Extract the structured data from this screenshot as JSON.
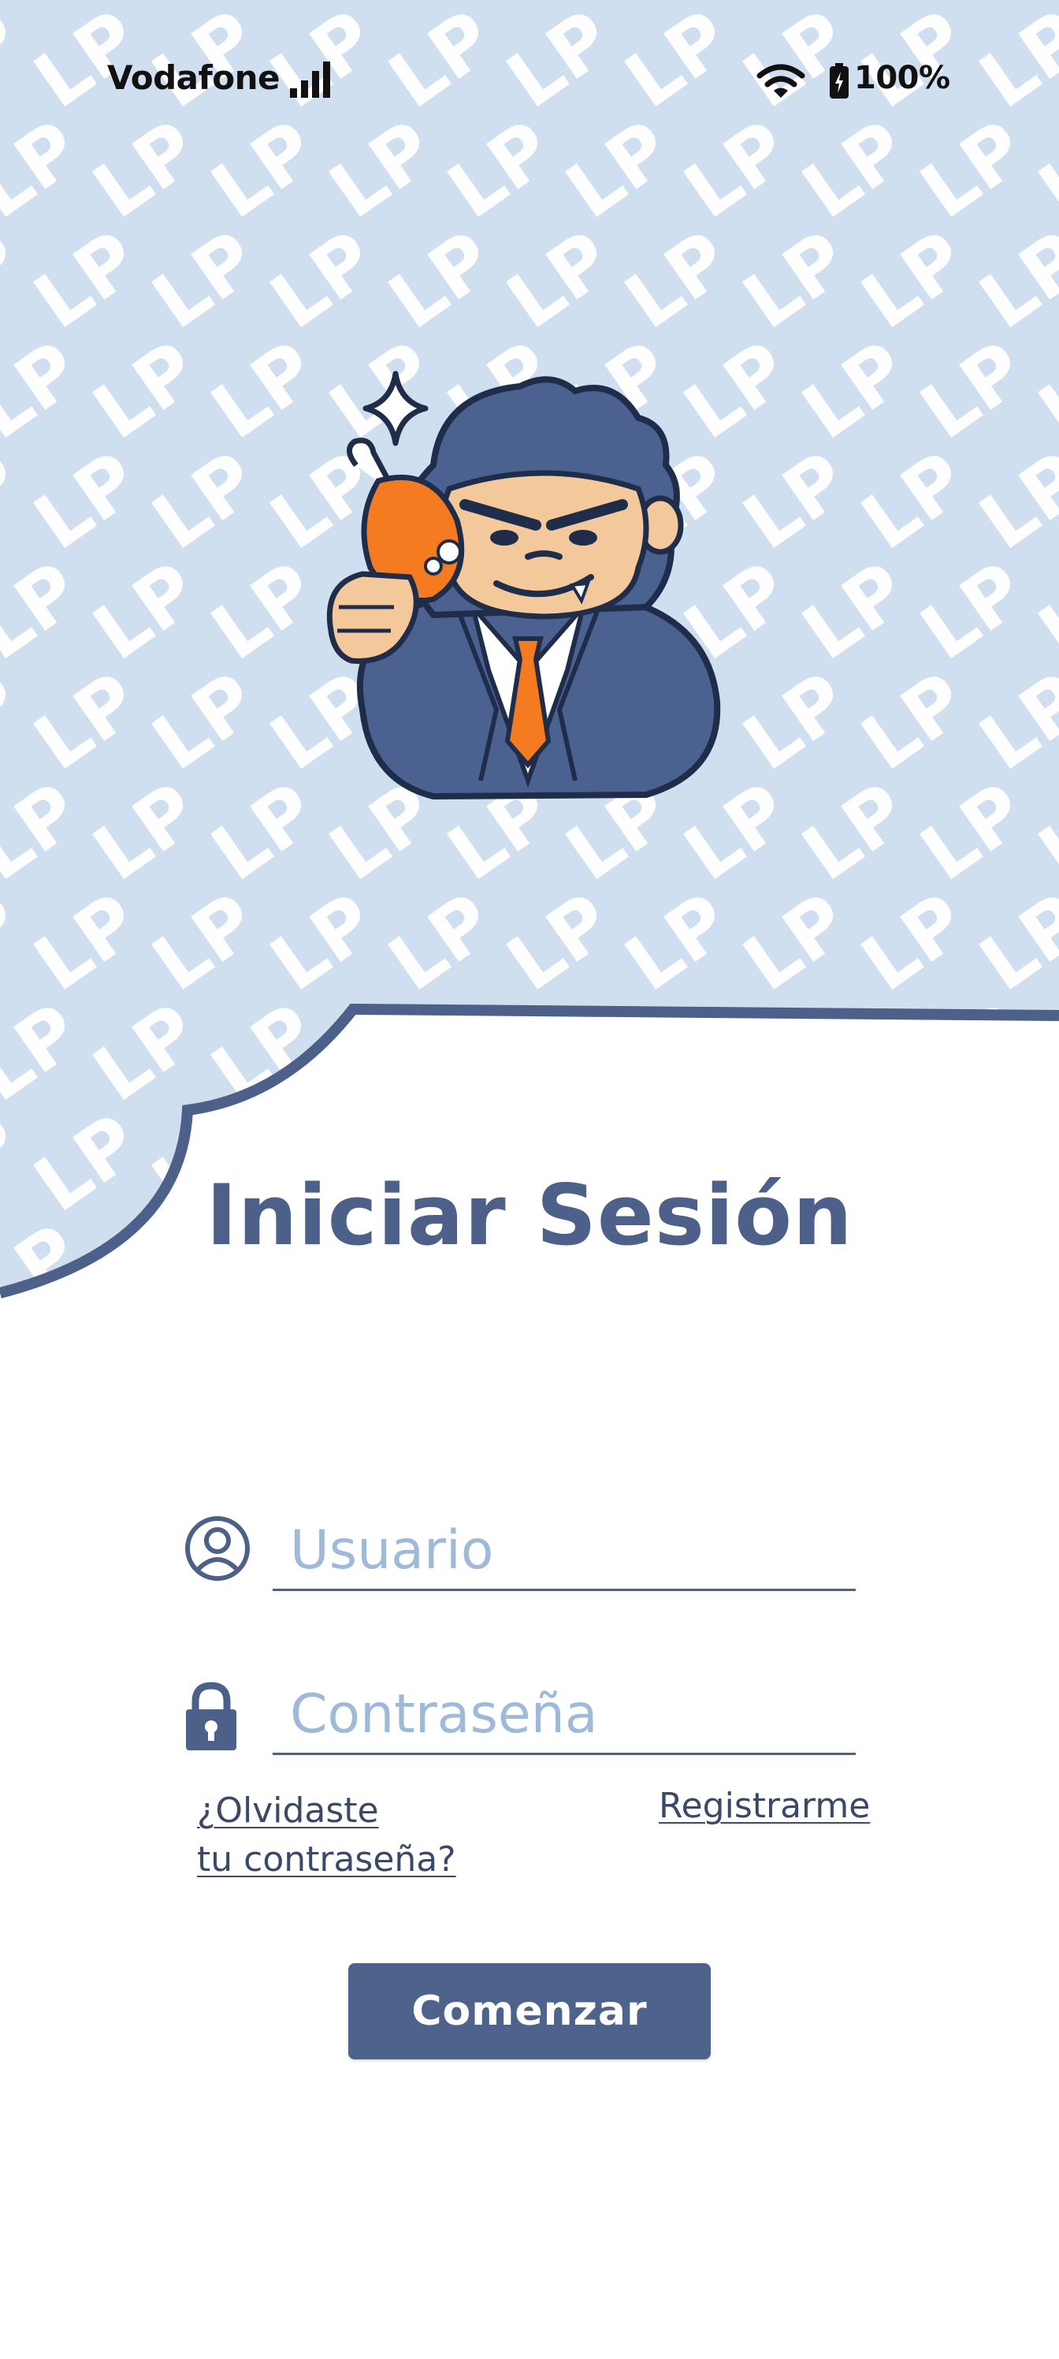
{
  "status_bar": {
    "carrier": "Vodafone",
    "battery": "100%",
    "icons": [
      "signal-bars-icon",
      "wifi-icon",
      "battery-charging-icon"
    ]
  },
  "background": {
    "pattern_text": "LP",
    "colors": {
      "sky": "#cfdff0",
      "pattern": "#ffffff",
      "edge": "#4c6089"
    }
  },
  "mascot": {
    "name": "gorilla-mascot-illustration"
  },
  "login": {
    "title": "Iniciar Sesión",
    "username": {
      "placeholder": "Usuario",
      "value": "",
      "icon": "user-circle-icon"
    },
    "password": {
      "placeholder": "Contraseña",
      "value": "",
      "icon": "lock-icon"
    },
    "forgot_line1": "¿Olvidaste",
    "forgot_line2": "tu contraseña?",
    "register_label": "Registrarme",
    "submit_label": "Comenzar"
  },
  "colors": {
    "primary": "#4e638c",
    "title": "#4c6089",
    "placeholder": "#9fb9d9",
    "link": "#3a4a66"
  }
}
